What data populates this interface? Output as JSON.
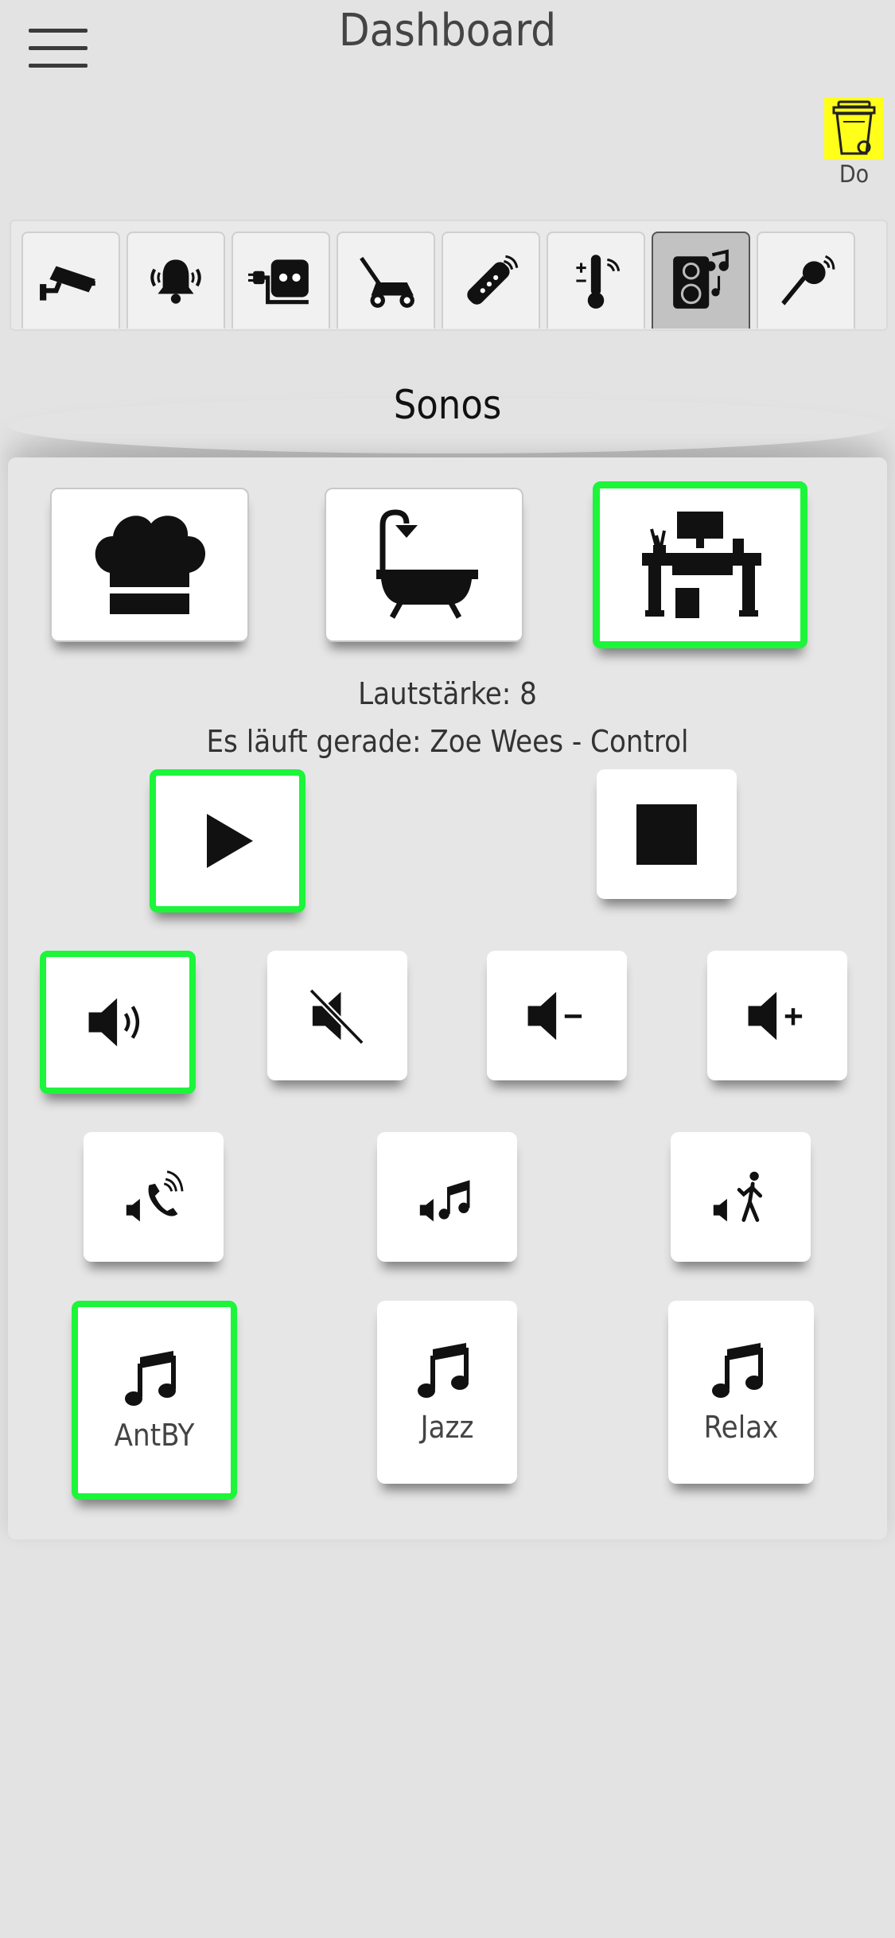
{
  "header": {
    "title": "Dashboard",
    "menu_icon": "hamburger-menu-icon"
  },
  "trash": {
    "label": "Do",
    "color": "#ffff1a",
    "icon": "trash-bin-icon"
  },
  "tabs": [
    {
      "icon": "security-camera-icon",
      "active": false
    },
    {
      "icon": "alarm-bell-icon",
      "active": false
    },
    {
      "icon": "power-socket-icon",
      "active": false
    },
    {
      "icon": "lawn-mower-icon",
      "active": false
    },
    {
      "icon": "remote-control-icon",
      "active": false
    },
    {
      "icon": "wireless-thermometer-icon",
      "active": false
    },
    {
      "icon": "speaker-music-icon",
      "active": true
    },
    {
      "icon": "microphone-icon",
      "active": false
    }
  ],
  "section": {
    "title": "Sonos"
  },
  "rooms": [
    {
      "icon": "chef-hat-icon",
      "selected": false
    },
    {
      "icon": "bathtub-icon",
      "selected": false
    },
    {
      "icon": "office-desk-icon",
      "selected": true
    }
  ],
  "status": {
    "volume": "Lautstärke: 8",
    "now_playing": "Es läuft gerade: Zoe Wees - Control"
  },
  "transport": [
    {
      "icon": "play-icon",
      "selected": true
    },
    {
      "icon": "stop-icon",
      "selected": false
    }
  ],
  "volume_controls": [
    {
      "icon": "volume-on-icon",
      "selected": true
    },
    {
      "icon": "volume-mute-icon",
      "selected": false
    },
    {
      "icon": "volume-down-icon",
      "selected": false
    },
    {
      "icon": "volume-up-icon",
      "selected": false
    }
  ],
  "sources": [
    {
      "icon": "phone-audio-icon"
    },
    {
      "icon": "music-audio-icon"
    },
    {
      "icon": "singer-audio-icon"
    }
  ],
  "playlists": [
    {
      "label": "AntBY",
      "icon": "music-note-icon",
      "selected": true
    },
    {
      "label": "Jazz",
      "icon": "music-note-icon",
      "selected": false
    },
    {
      "label": "Relax",
      "icon": "music-note-icon",
      "selected": false
    }
  ],
  "colors": {
    "selected_border": "#1cf53a",
    "background": "#e3e3e3"
  }
}
